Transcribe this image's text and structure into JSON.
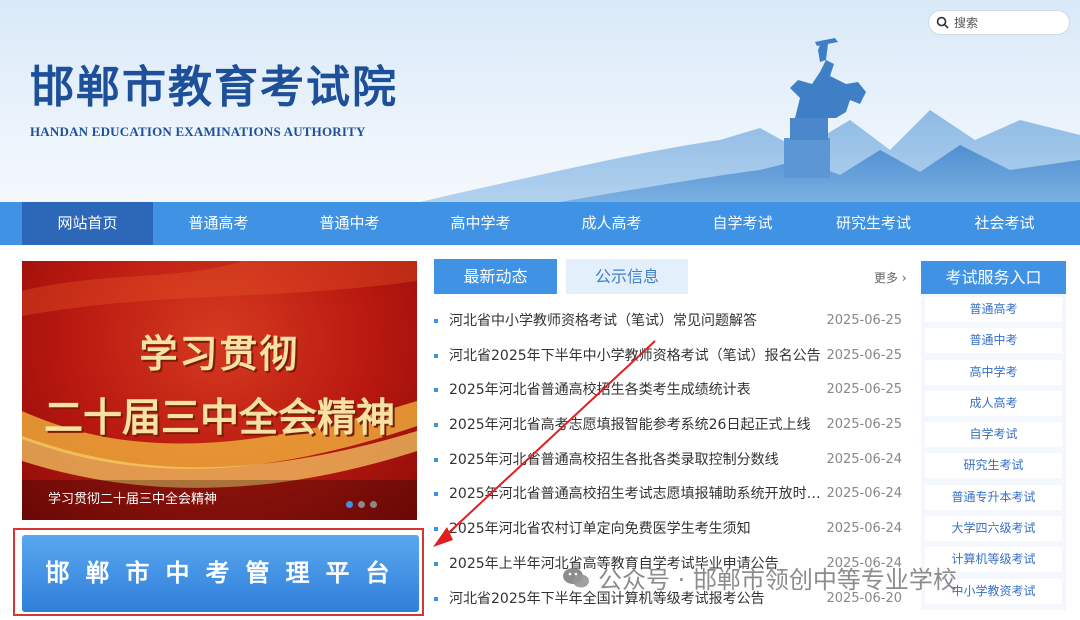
{
  "header": {
    "title": "邯郸市教育考试院",
    "subtitle": "HANDAN EDUCATION EXAMINATIONS AUTHORITY",
    "search_placeholder": "搜索"
  },
  "nav": {
    "items": [
      "网站首页",
      "普通高考",
      "普通中考",
      "高中学考",
      "成人高考",
      "自学考试",
      "研究生考试",
      "社会考试"
    ],
    "active_index": 0
  },
  "slider": {
    "slogan_line1": "学习贯彻",
    "slogan_line2": "二十届三中全会精神",
    "caption": "学习贯彻二十届三中全会精神",
    "active_dot": 0
  },
  "platform": {
    "label": "邯郸市中考管理平台"
  },
  "tabs": {
    "news": "最新动态",
    "notice": "公示信息",
    "more": "更多"
  },
  "news": [
    {
      "title": "河北省中小学教师资格考试（笔试）常见问题解答",
      "date": "2025-06-25"
    },
    {
      "title": "河北省2025年下半年中小学教师资格考试（笔试）报名公告",
      "date": "2025-06-25"
    },
    {
      "title": "2025年河北省普通高校招生各类考生成绩统计表",
      "date": "2025-06-25"
    },
    {
      "title": "2025年河北省高考志愿填报智能参考系统26日起正式上线",
      "date": "2025-06-25"
    },
    {
      "title": "2025年河北省普通高校招生各批各类录取控制分数线",
      "date": "2025-06-24"
    },
    {
      "title": "2025年河北省普通高校招生考试志愿填报辅助系统开放时间...",
      "date": "2025-06-24"
    },
    {
      "title": "2025年河北省农村订单定向免费医学生考生须知",
      "date": "2025-06-24"
    },
    {
      "title": "2025年上半年河北省高等教育自学考试毕业申请公告",
      "date": "2025-06-24"
    },
    {
      "title": "河北省2025年下半年全国计算机等级考试报考公告",
      "date": "2025-06-20"
    }
  ],
  "service": {
    "title": "考试服务入口",
    "items": [
      "普通高考",
      "普通中考",
      "高中学考",
      "成人高考",
      "自学考试",
      "研究生考试",
      "普通专升本考试",
      "大学四六级考试",
      "计算机等级考试",
      "中小学教资考试"
    ]
  },
  "watermark": {
    "text": "公众号 · 邯郸市领创中等专业学校"
  },
  "colors": {
    "nav_blue": "#3f92e4",
    "nav_active": "#2d67b7",
    "title_blue": "#1e4f99",
    "highlight_red": "#d93434"
  }
}
